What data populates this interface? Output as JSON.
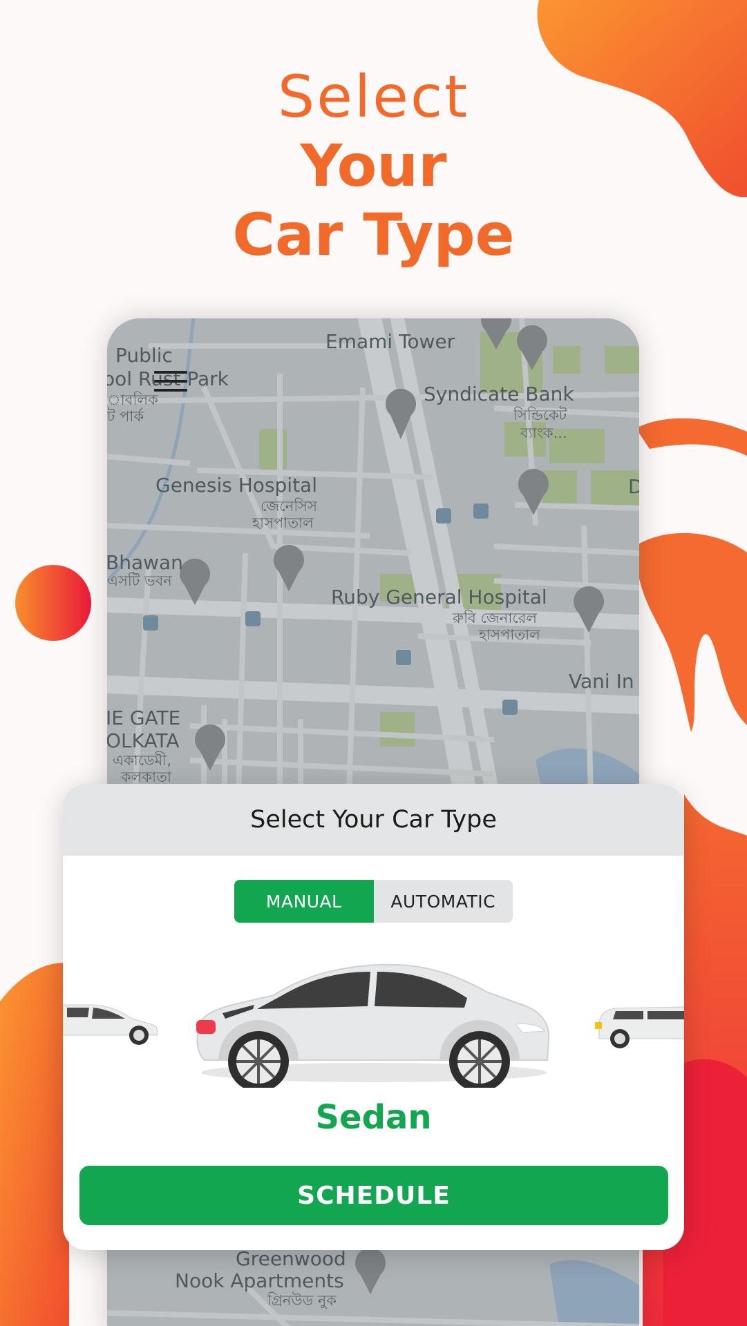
{
  "headline": {
    "line1": "Select",
    "line2": "Your",
    "line3": "Car Type"
  },
  "map": {
    "labels": {
      "public": "Public",
      "park": "ool Rust Park",
      "park_bn1": "াবলিক",
      "park_bn2": "ট পার্ক",
      "emami": "Emami Tower",
      "syndicate": "Syndicate Bank",
      "syndicate_bn1": "সিন্ডিকেট",
      "syndicate_bn2": "ব্যাংক...",
      "genesis": "Genesis Hospital",
      "genesis_bn1": "জেনেসিস",
      "genesis_bn2": "হাসপাতাল",
      "bhawan": "Bhawan",
      "bhawan_bn": "এসটি ভবন",
      "ruby": "Ruby General Hospital",
      "ruby_bn1": "রুবি জেনারেল",
      "ruby_bn2": "হাসপাতাল",
      "vani": "Vani In",
      "gate": "IE GATE",
      "kolkata": "OLKATA",
      "kolkata_bn1": "একাডেমী,",
      "kolkata_bn2": "কলকাতা",
      "right_d": "D",
      "greenwood": "Greenwood",
      "nook": "Nook Apartments",
      "nook_bn": "গ্রিনউড নুক"
    }
  },
  "card": {
    "title": "Select Your Car Type",
    "toggle": {
      "manual": "MANUAL",
      "automatic": "AUTOMATIC",
      "selected": "manual"
    },
    "selected_car": "Sedan",
    "schedule_label": "SCHEDULE"
  },
  "colors": {
    "accent_orange": "#f26a2a",
    "brand_green": "#12a650",
    "blob_red": "#ee2a3c"
  }
}
